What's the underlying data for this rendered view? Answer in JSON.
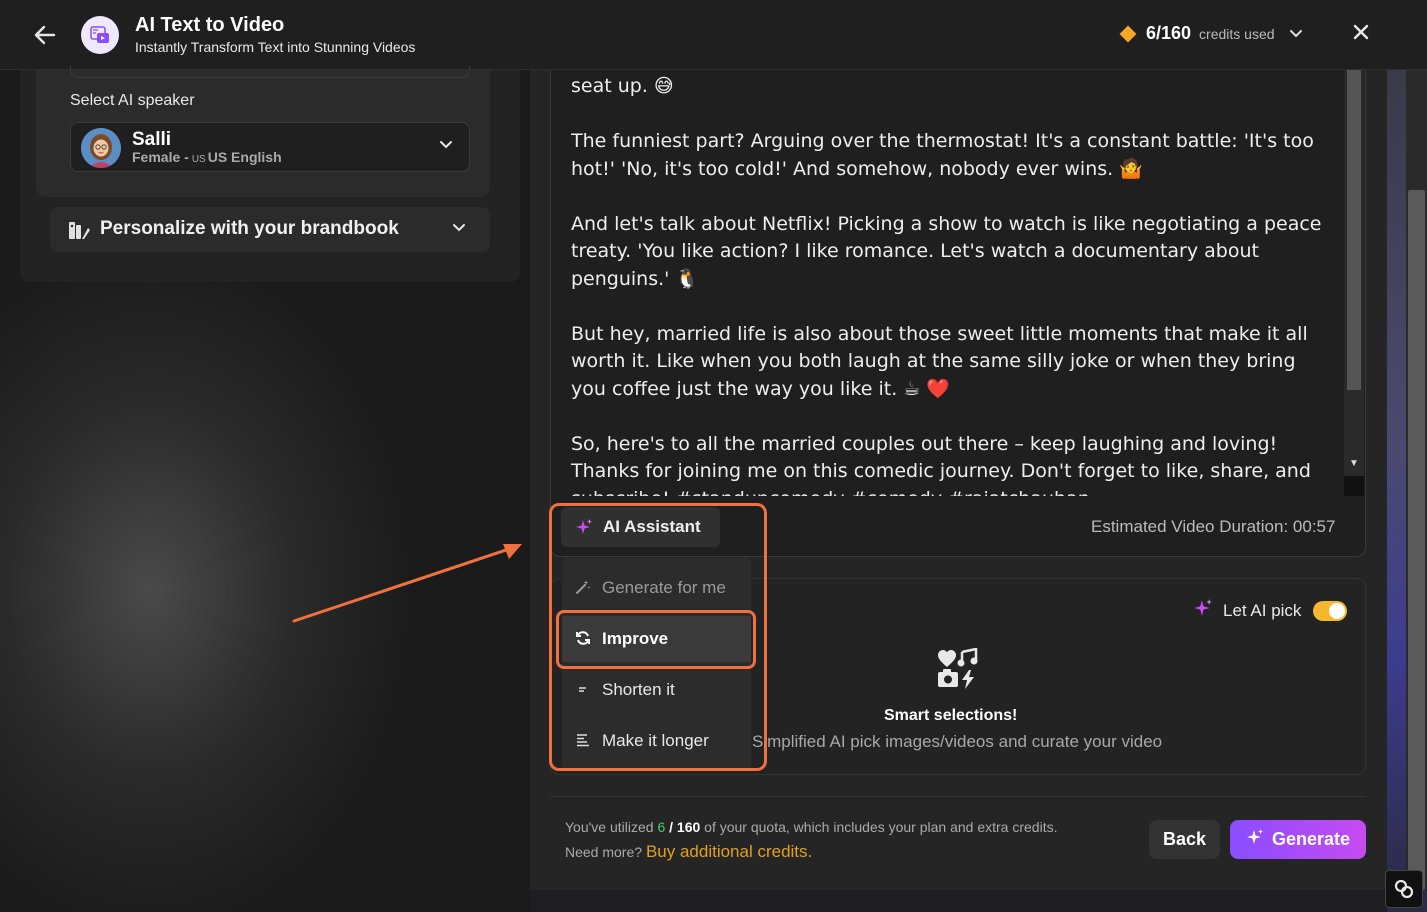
{
  "header": {
    "title": "AI Text to Video",
    "subtitle": "Instantly Transform Text into Stunning Videos",
    "credits_count": "6/160",
    "credits_label": "credits used"
  },
  "speaker": {
    "label": "Select AI speaker",
    "name": "Salli",
    "gender": "Female -",
    "flag": "US",
    "language": "US English"
  },
  "brandbook": {
    "label": "Personalize with your brandbook"
  },
  "script": {
    "paragraphs": [
      "seat up. 😅",
      "The funniest part? Arguing over the thermostat! It's a constant battle: 'It's too hot!' 'No, it's too cold!' And somehow, nobody ever wins. 🤷",
      "And let's talk about Netflix! Picking a show to watch is like negotiating a peace treaty. 'You like action? I like romance. Let's watch a documentary about penguins.' 🐧",
      "But hey, married life is also about those sweet little moments that make it all worth it. Like when you both laugh at the same silly joke or when they bring you coffee just the way you like it. ☕ ❤️",
      "So, here's to all the married couples out there – keep laughing and loving! Thanks for joining me on this comedic journey. Don't forget to like, share, and subscribe! #standupcomedy #comedy #rajatchauhan"
    ]
  },
  "assistant": {
    "button_label": "AI Assistant",
    "duration": "Estimated Video Duration: 00:57",
    "menu": [
      {
        "label": "Generate for me",
        "icon": "magic-wand-icon"
      },
      {
        "label": "Improve",
        "icon": "refresh-icon"
      },
      {
        "label": "Shorten it",
        "icon": "shorten-icon"
      },
      {
        "label": "Make it longer",
        "icon": "lengthen-icon"
      }
    ]
  },
  "media": {
    "let_ai_label": "Let AI pick",
    "let_ai_enabled": true,
    "smart_title": "Smart selections!",
    "smart_desc": "Simplified AI pick images/videos and curate your video"
  },
  "footer": {
    "quota_prefix": "You've utilized",
    "quota_used": "6",
    "quota_total": "/ 160",
    "quota_suffix": "of your quota, which includes your plan and extra credits.",
    "need_more": "Need more?",
    "buy_link": "Buy additional credits.",
    "back_label": "Back",
    "generate_label": "Generate"
  },
  "colors": {
    "accent_orange": "#f0703e",
    "generate_gradient_start": "#8a4dff",
    "generate_gradient_end": "#c64bf0",
    "credits_diamond": "#f5a623",
    "toggle_on": "#f5b82e",
    "quota_used": "#3ecf6a",
    "buy_link": "#e0a020"
  }
}
